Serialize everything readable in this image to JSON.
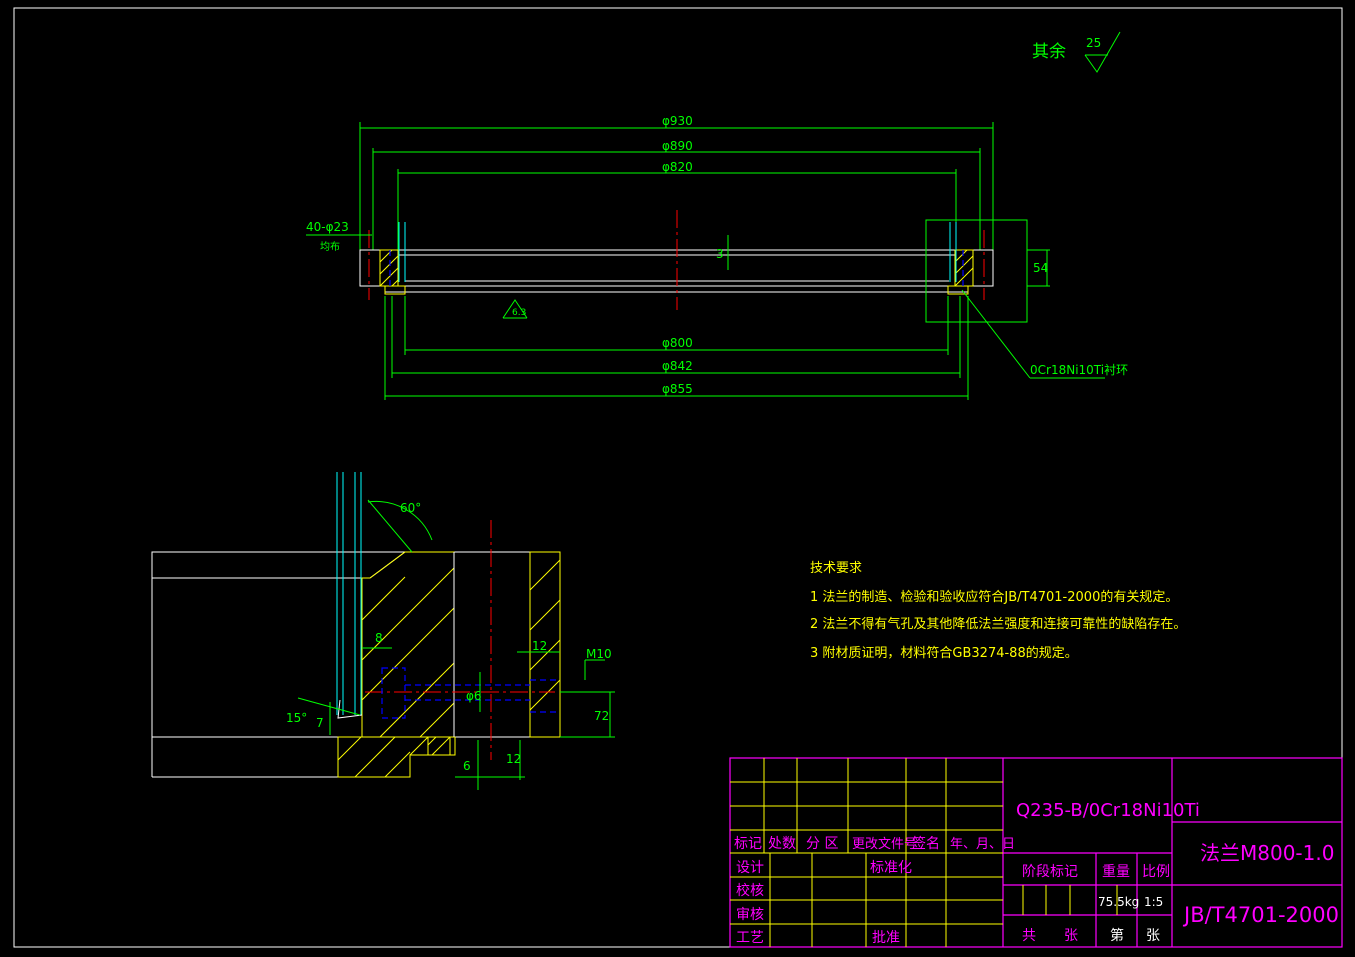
{
  "roughness": {
    "label": "其余",
    "value": "25"
  },
  "dims_top": {
    "d930": "φ930",
    "d890": "φ890",
    "d820": "φ820",
    "d800": "φ800",
    "d842": "φ842",
    "d855": "φ855",
    "holes": "40-φ23",
    "holes_note": "均布",
    "h54": "54",
    "h3": "3",
    "ra63": "6.3"
  },
  "lining_note": "0Cr18Ni10Ti衬环",
  "dims_detail": {
    "angle60": "60°",
    "angle15": "15°",
    "d8": "8",
    "d7": "7",
    "d12a": "12",
    "m10": "M10",
    "d6": "φ6",
    "d72": "72",
    "d6b": "6",
    "d12b": "12"
  },
  "tech": {
    "title": "技术要求",
    "items": [
      "1 法兰的制造、检验和验收应符合JB/T4701-2000的有关规定。",
      "2 法兰不得有气孔及其他降低法兰强度和连接可靠性的缺陷存在。",
      "3 附材质证明，材料符合GB3274-88的规定。"
    ]
  },
  "title_block": {
    "material": "Q235-B/0Cr18Ni10Ti",
    "name": "法兰M800-1.0",
    "standard": "JB/T4701-2000",
    "rev_headers": [
      "标记",
      "处数",
      "分 区",
      "更改文件号",
      "签名",
      "年、月、日"
    ],
    "roles": [
      "设计",
      "校核",
      "审核",
      "工艺"
    ],
    "standardize": "标准化",
    "approve": "批准",
    "stage": "阶段标记",
    "weight_label": "重量",
    "scale_label": "比例",
    "weight": "75.5kg",
    "scale": "1:5",
    "total": "共",
    "sheets": "张",
    "sheet_no": "第",
    "sheet_unit": "张"
  }
}
